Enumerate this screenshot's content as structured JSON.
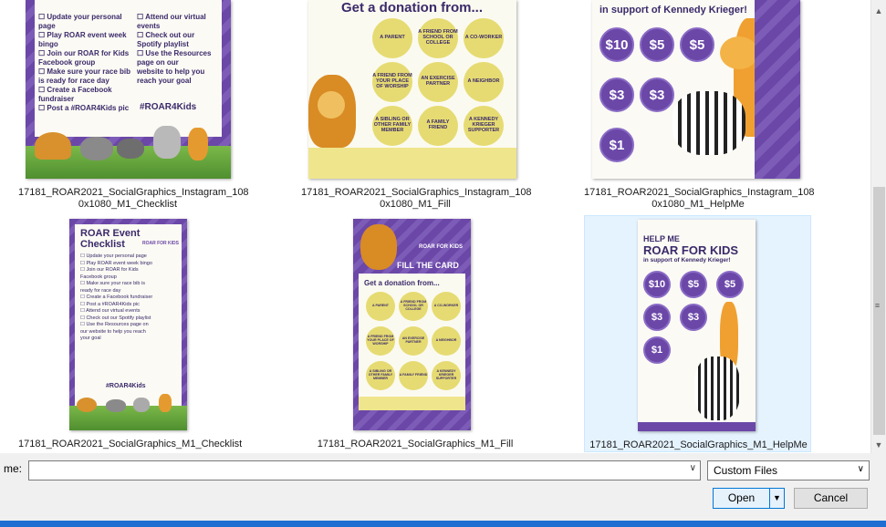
{
  "files": [
    {
      "caption_line1": "17181_ROAR2021_SocialGraphics_Instagram_108",
      "caption_line2": "0x1080_M1_Checklist",
      "checklist_left": [
        "☐ Update your personal",
        "   page",
        "☐ Play ROAR event week",
        "   bingo",
        "☐ Join our ROAR for Kids",
        "   Facebook group",
        "☐ Make sure your race bib",
        "   is ready for race day",
        "☐ Create a Facebook",
        "   fundraiser",
        "☐ Post a #ROAR4Kids pic"
      ],
      "checklist_right": [
        "☐ Attend our virtual",
        "   events",
        "☐ Check out our",
        "   Spotify playlist",
        "☐ Use the Resources",
        "   page on our",
        "   website to help you",
        "   reach your goal"
      ],
      "hashtag": "#ROAR4Kids"
    },
    {
      "caption_line1": "17181_ROAR2021_SocialGraphics_Instagram_108",
      "caption_line2": "0x1080_M1_Fill",
      "heading": "Get a donation from...",
      "circles": [
        "A PARENT",
        "A FRIEND FROM SCHOOL OR COLLEGE",
        "A CO-WORKER",
        "A FRIEND FROM YOUR PLACE OF WORSHIP",
        "AN EXERCISE PARTNER",
        "A NEIGHBOR",
        "A SIBLING OR OTHER FAMILY MEMBER",
        "A FAMILY FRIEND",
        "A KENNEDY KRIEGER SUPPORTER"
      ]
    },
    {
      "caption_line1": "17181_ROAR2021_SocialGraphics_Instagram_108",
      "caption_line2": "0x1080_M1_HelpMe",
      "tagline": "in support of Kennedy Krieger!",
      "amounts": [
        "$10",
        "$5",
        "$5",
        "$3",
        "$3",
        "$1"
      ]
    },
    {
      "caption": "17181_ROAR2021_SocialGraphics_M1_Checklist",
      "title_line1": "ROAR Event",
      "title_line2": "Checklist",
      "logo": "ROAR FOR KIDS",
      "items": [
        "☐ Update your personal page",
        "☐ Play ROAR event week bingo",
        "☐ Join our ROAR for Kids",
        "   Facebook group",
        "☐ Make sure your race bib is",
        "   ready for race day",
        "☐ Create a Facebook fundraiser",
        "☐ Post a #ROAR4Kids pic",
        "☐ Attend our virtual events",
        "☐ Check out our Spotify playlist",
        "☐ Use the Resources page on",
        "   our website to help you reach",
        "   your goal"
      ],
      "hashtag": "#ROAR4Kids"
    },
    {
      "caption": "17181_ROAR2021_SocialGraphics_M1_Fill",
      "banner": "FILL THE CARD",
      "logo": "ROAR FOR KIDS",
      "heading": "Get a donation from...",
      "circles": [
        "A PARENT",
        "A FRIEND FROM SCHOOL OR COLLEGE",
        "A CO-WORKER",
        "A FRIEND FROM YOUR PLACE OF WORSHIP",
        "AN EXERCISE PARTNER",
        "A NEIGHBOR",
        "A SIBLING OR OTHER FAMILY MEMBER",
        "A FAMILY FRIEND",
        "A KENNEDY KRIEGER SUPPORTER"
      ]
    },
    {
      "caption": "17181_ROAR2021_SocialGraphics_M1_HelpMe",
      "line1": "HELP ME",
      "line2": "ROAR FOR KIDS",
      "tagline": "in support of Kennedy Krieger!",
      "amounts": [
        "$10",
        "$5",
        "$5",
        "$3",
        "$3",
        "$1"
      ]
    }
  ],
  "bottom": {
    "name_label": "me:",
    "name_value": "",
    "file_type": "Custom Files",
    "open_label": "Open",
    "cancel_label": "Cancel"
  },
  "colors": {
    "purple": "#6b47a8",
    "yellow": "#e6db72",
    "selection": "#e5f3ff"
  }
}
